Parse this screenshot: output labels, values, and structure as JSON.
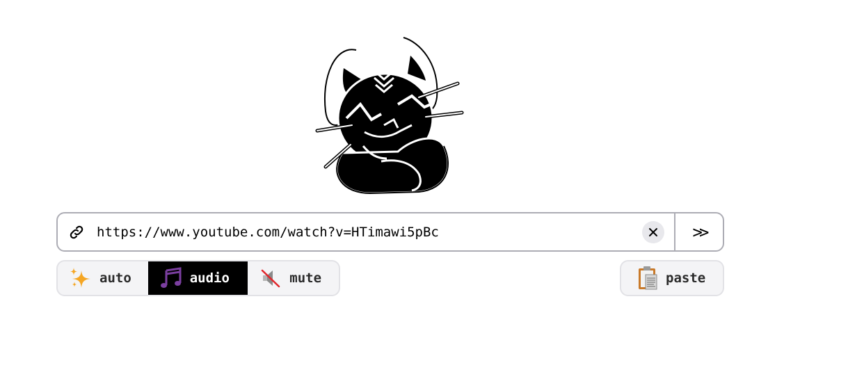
{
  "url_bar": {
    "value": "https://www.youtube.com/watch?v=HTimawi5pBc",
    "submit_label": ">>"
  },
  "download_mode": {
    "options": [
      {
        "label": "auto",
        "icon": "sparkles-icon",
        "active": false
      },
      {
        "label": "audio",
        "icon": "musical-notes-icon",
        "active": true
      },
      {
        "label": "mute",
        "icon": "muted-speaker-icon",
        "active": false
      }
    ],
    "selected": "audio"
  },
  "paste": {
    "label": "paste",
    "icon": "clipboard-icon"
  },
  "logo": {
    "icon": "cat-mascot-icon"
  },
  "colors": {
    "url_border": "#acacb4",
    "button_bg": "#f4f4f6",
    "active_bg": "#000000",
    "active_text": "#ffffff",
    "sparkle": "#f5a623",
    "music_notes": "#7b3fa0",
    "mute_slash": "#e0262b"
  }
}
